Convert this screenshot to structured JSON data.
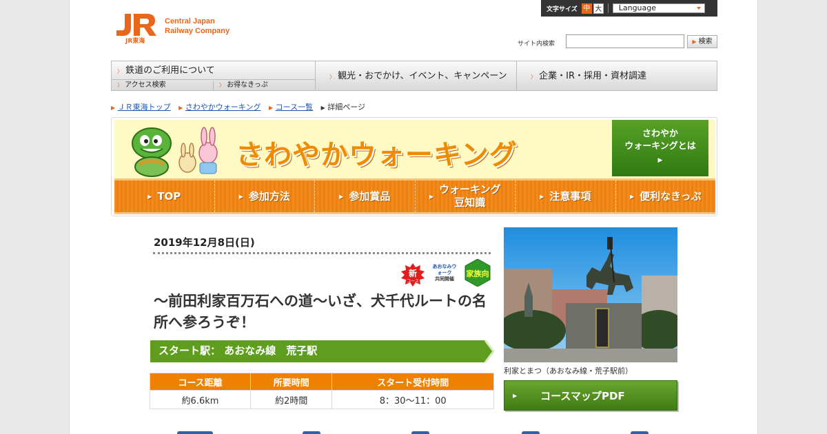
{
  "header": {
    "logo_mark": "JR東海",
    "logo_line1": "Central Japan",
    "logo_line2": "Railway Company",
    "font_size_label": "文字サイズ",
    "font_size_mid": "中",
    "font_size_big": "大",
    "language_label": "Language",
    "search_label": "サイト内検索",
    "search_value": "",
    "search_button": "検索"
  },
  "gnav": {
    "item1": "鉄道のご利用について",
    "sub1": "アクセス検索",
    "sub2": "お得なきっぷ",
    "item2": "観光・おでかけ、イベント、キャンペーン",
    "item3": "企業・IR・採用・資材調達"
  },
  "breadcrumb": {
    "items": [
      "ＪＲ東海トップ",
      "さわやかウォーキング",
      "コース一覧"
    ],
    "current": "詳細ページ"
  },
  "walking": {
    "title": "さわやかウォーキング",
    "about_line1": "さわやか",
    "about_line2": "ウォーキングとは",
    "nav": [
      "TOP",
      "参加方法",
      "参加賞品",
      "ウォーキング",
      "豆知識",
      "注意事項",
      "便利なきっぷ"
    ]
  },
  "course": {
    "date": "2019年12月8日(日)",
    "badge_new": "新",
    "badge_new_sub": "コース",
    "badge_walk_line1": "あおなみウォーク",
    "badge_walk_line2": "共同開催",
    "badge_family": "家族向",
    "title": "～前田利家百万石への道～いざ、犬千代ルートの名所へ参ろうぞ！",
    "start_label": "スタート駅：",
    "start_value": "あおなみ線　荒子駅",
    "table_headers": [
      "コース距離",
      "所要時間",
      "スタート受付時間"
    ],
    "table_values": [
      "約6.6km",
      "約2時間",
      "8：30～11：00"
    ],
    "photo_caption": "利家とまつ（あおなみ線・荒子駅前）",
    "map_button": "コースマップPDF"
  },
  "colors": {
    "jr_orange": "#e9661d",
    "walking_orange": "#ef8010",
    "walking_green": "#3f7c14",
    "link_blue": "#1a57b0"
  }
}
